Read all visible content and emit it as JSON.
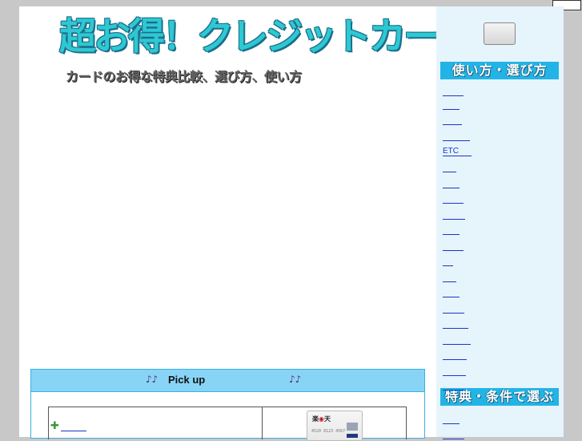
{
  "header": {
    "title": "超お得！クレジットカード比較",
    "subtitle": "カードのお得な特典比較、選び方、使い方"
  },
  "pickup": {
    "notes_icon": "♪♪",
    "title": "Pick up",
    "plus_icon": "✚",
    "card": {
      "brand_prefix": "楽",
      "brand_mark": "◉",
      "brand_suffix": "天",
      "number": "4520 0123 4567"
    }
  },
  "sidebar": {
    "section1_title": "使い方・選び方",
    "section2_title": "特典・条件で選ぶ",
    "links": [
      "",
      "",
      "",
      "",
      "ETC",
      "",
      "",
      "",
      "",
      "",
      "",
      "",
      "",
      "",
      "",
      "",
      "",
      "",
      "",
      ""
    ]
  },
  "colors": {
    "page_bg": "#c8c8c8",
    "sidebar_bg": "#e6f4fc",
    "section_header_bg": "#22b4e6",
    "pickup_header_bg": "#88d4f6",
    "link": "#1a36c9",
    "logo_text": "#2ec8d2"
  }
}
